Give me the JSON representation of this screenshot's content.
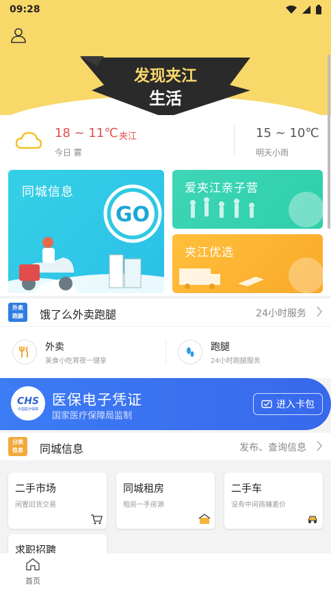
{
  "status_bar": {
    "time": "09:28"
  },
  "hero": {
    "banner_line1": "发现夹江",
    "banner_line2": "生活"
  },
  "weather": {
    "today_temp": "18 ~ 11℃",
    "city": "夹江",
    "today_label": "今日 雾",
    "tomorrow_temp": "15 ~ 10℃",
    "tomorrow_label": "明天小雨"
  },
  "tiles": {
    "city_info": "同城信息",
    "go_label": "GO",
    "parent_camp": "爱夹江亲子营",
    "local_select": "夹江优选"
  },
  "delivery_section": {
    "tag_line1": "外卖",
    "tag_line2": "跑腿",
    "title": "饿了么外卖跑腿",
    "right_text": "24小时服务",
    "items": [
      {
        "name": "外卖",
        "desc": "美食小吃宵夜一键享"
      },
      {
        "name": "跑腿",
        "desc": "24小时跑腿服务"
      }
    ]
  },
  "insurance": {
    "logo_text": "CHS",
    "logo_sub": "中国医疗保障",
    "title": "医保电子凭证",
    "subtitle": "国家医疗保障局监制",
    "button": "进入卡包"
  },
  "info_section": {
    "tag_line1": "分类",
    "tag_line2": "信息",
    "title": "同城信息",
    "right_text": "发布、查询信息"
  },
  "cards": [
    {
      "title": "二手市场",
      "desc": "闲置旧货交易"
    },
    {
      "title": "同城租房",
      "desc": "租房一手房源"
    },
    {
      "title": "二手车",
      "desc": "没有中间商赚差价"
    },
    {
      "title": "求职招聘",
      "desc": ""
    }
  ],
  "tabbar": {
    "home": "首页"
  },
  "colors": {
    "header_yellow": "#f9d86a",
    "weather_red": "#e24c4c",
    "insurance_blue": "#3c7cf5"
  }
}
